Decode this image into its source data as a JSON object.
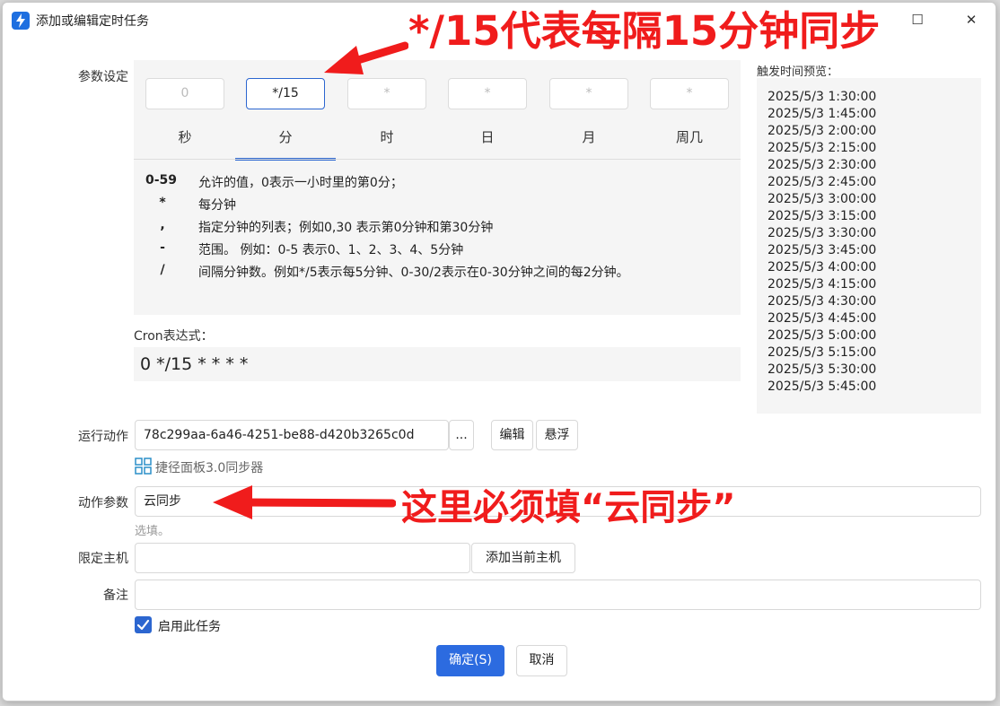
{
  "window": {
    "title": "添加或编辑定时任务",
    "maximize_glyph": "☐",
    "close_glyph": "✕"
  },
  "labels": {
    "params": "参数设定",
    "action": "运行动作",
    "action_params": "动作参数",
    "host": "限定主机",
    "note": "备注"
  },
  "cron_fields": [
    {
      "label": "秒",
      "value": "0",
      "active": false
    },
    {
      "label": "分",
      "value": "*/15",
      "active": true
    },
    {
      "label": "时",
      "value": "*",
      "active": false
    },
    {
      "label": "日",
      "value": "*",
      "active": false
    },
    {
      "label": "月",
      "value": "*",
      "active": false
    },
    {
      "label": "周几",
      "value": "*",
      "active": false
    }
  ],
  "help": [
    {
      "symbol": "0-59",
      "text": "允许的值，0表示一小时里的第0分；"
    },
    {
      "symbol": "*",
      "text": "每分钟"
    },
    {
      "symbol": ",",
      "text": "指定分钟的列表；例如0,30 表示第0分钟和第30分钟"
    },
    {
      "symbol": "-",
      "text": "范围。 例如：0-5 表示0、1、2、3、4、5分钟"
    },
    {
      "symbol": "/",
      "text": "间隔分钟数。例如*/5表示每5分钟、0-30/2表示在0-30分钟之间的每2分钟。"
    }
  ],
  "cron": {
    "label": "Cron表达式：",
    "expression": "0 */15 * * * *"
  },
  "preview": {
    "label": "触发时间预览：",
    "times": [
      "2025/5/3 1:30:00",
      "2025/5/3 1:45:00",
      "2025/5/3 2:00:00",
      "2025/5/3 2:15:00",
      "2025/5/3 2:30:00",
      "2025/5/3 2:45:00",
      "2025/5/3 3:00:00",
      "2025/5/3 3:15:00",
      "2025/5/3 3:30:00",
      "2025/5/3 3:45:00",
      "2025/5/3 4:00:00",
      "2025/5/3 4:15:00",
      "2025/5/3 4:30:00",
      "2025/5/3 4:45:00",
      "2025/5/3 5:00:00",
      "2025/5/3 5:15:00",
      "2025/5/3 5:30:00",
      "2025/5/3 5:45:00"
    ]
  },
  "action": {
    "value": "78c299aa-6a46-4251-be88-d420b3265c0d",
    "browse_label": "...",
    "edit_label": "编辑",
    "float_label": "悬浮",
    "link_text": "捷径面板3.0同步器"
  },
  "action_params": {
    "value": "云同步",
    "hint": "选填。"
  },
  "host": {
    "value": "",
    "add_label": "添加当前主机"
  },
  "note": {
    "value": ""
  },
  "enable": {
    "label": "启用此任务",
    "checked": true
  },
  "footer": {
    "ok_label": "确定(S)",
    "cancel_label": "取消"
  },
  "annotations": {
    "top": "*/15代表每隔15分钟同步",
    "middle": "这里必须填“云同步”"
  },
  "colors": {
    "accent": "#2c66d0",
    "annotation": "#f01c1c"
  }
}
